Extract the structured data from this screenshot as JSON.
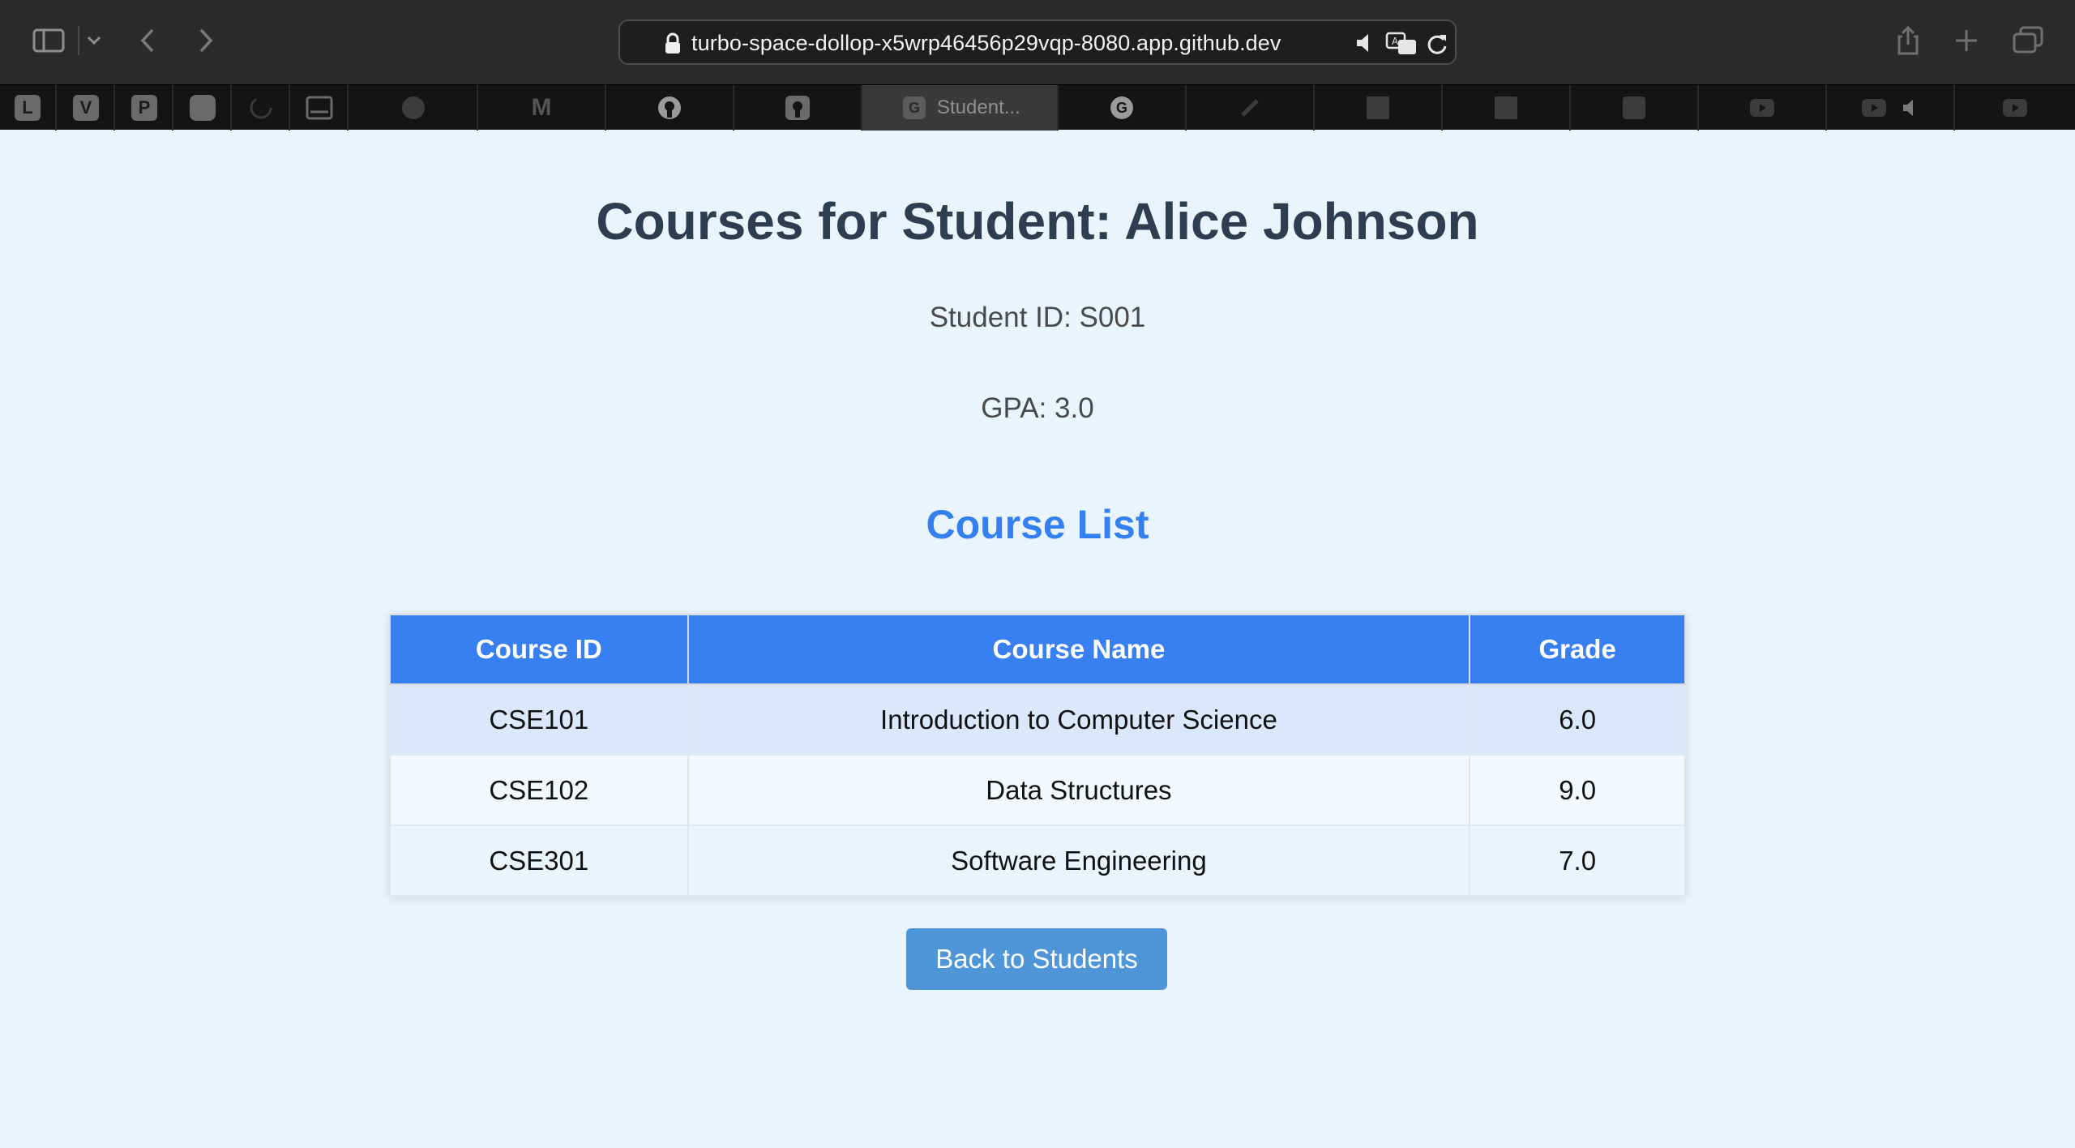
{
  "browser": {
    "url": "turbo-space-dollop-x5wrp46456p29vqp-8080.app.github.dev",
    "pinned_tabs": [
      "L",
      "V",
      "P"
    ],
    "active_tab": {
      "favicon_letter": "G",
      "title": "Student..."
    },
    "other_tab_favicons": [
      "M",
      "github",
      "github",
      "G"
    ]
  },
  "page": {
    "title": "Courses for Student: Alice Johnson",
    "student_id": "Student ID: S001",
    "gpa": "GPA: 3.0",
    "section_title": "Course List",
    "table": {
      "headers": [
        "Course ID",
        "Course Name",
        "Grade"
      ],
      "rows": [
        [
          "CSE101",
          "Introduction to Computer Science",
          "6.0"
        ],
        [
          "CSE102",
          "Data Structures",
          "9.0"
        ],
        [
          "CSE301",
          "Software Engineering",
          "7.0"
        ]
      ]
    },
    "back_button": "Back to Students"
  },
  "colors": {
    "page_bg": "#eaf4fd",
    "title": "#2c3e50",
    "accent": "#3480f0",
    "table_header": "#3880f2",
    "button": "#4f96d9"
  }
}
